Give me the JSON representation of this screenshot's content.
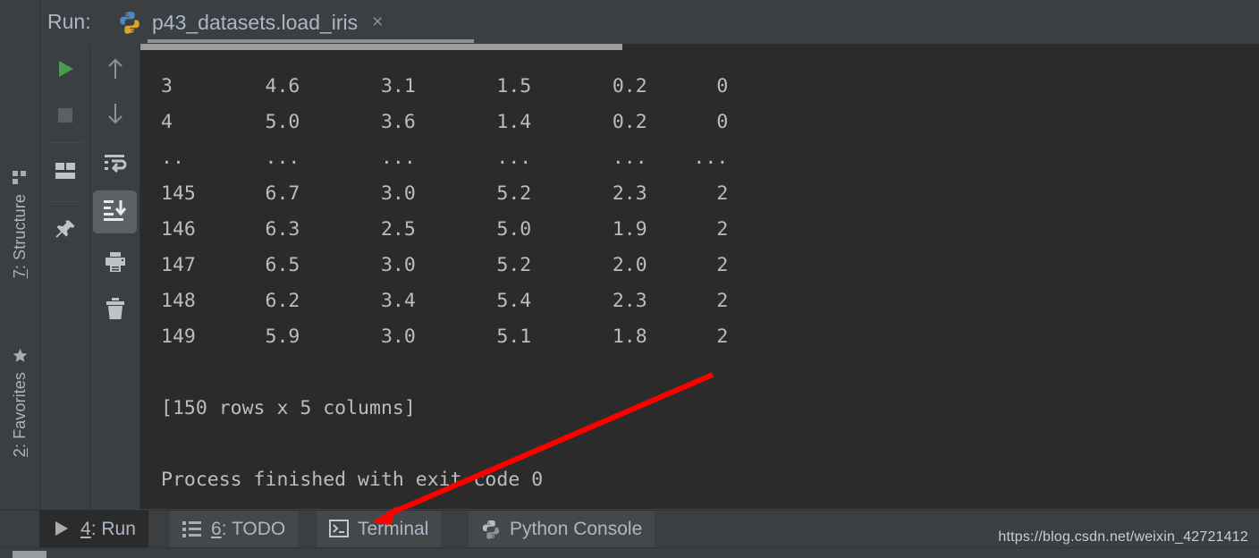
{
  "window": {
    "run_label": "Run:",
    "tab_title": "p43_datasets.load_iris",
    "tab_close": "×",
    "tab_icon": "python-icon"
  },
  "left_stripe": {
    "items": [
      {
        "label_mnemonic": "7",
        "label_rest": ": Structure",
        "icon": "structure-icon",
        "name": "structure"
      },
      {
        "label_mnemonic": "2",
        "label_rest": ": Favorites",
        "icon": "star-icon",
        "name": "favorites"
      }
    ]
  },
  "toolbar_run": {
    "buttons": [
      {
        "name": "rerun-button",
        "icon": "play-icon",
        "active": false
      },
      {
        "name": "stop-button",
        "icon": "stop-square-icon",
        "active": false
      },
      {
        "name": "restore-layout-button",
        "icon": "layout-icon",
        "active": false
      },
      {
        "name": "pin-tab-button",
        "icon": "pin-icon",
        "active": false
      }
    ]
  },
  "toolbar_console": {
    "buttons": [
      {
        "name": "up-the-stack-button",
        "icon": "arrow-up-icon",
        "active": false
      },
      {
        "name": "down-the-stack-button",
        "icon": "arrow-down-icon",
        "active": false
      },
      {
        "name": "soft-wrap-button",
        "icon": "soft-wrap-icon",
        "active": false
      },
      {
        "name": "scroll-to-end-button",
        "icon": "scroll-to-end-icon",
        "active": true
      },
      {
        "name": "print-button",
        "icon": "printer-icon",
        "active": false
      },
      {
        "name": "clear-all-button",
        "icon": "trash-icon",
        "active": false
      }
    ]
  },
  "console": {
    "output": "3        4.6       3.1       1.5       0.2      0\n4        5.0       3.6       1.4       0.2      0\n..       ...       ...       ...       ...    ...\n145      6.7       3.0       5.2       2.3      2\n146      6.3       2.5       5.0       1.9      2\n147      6.5       3.0       5.2       2.0      2\n148      6.2       3.4       5.4       2.3      2\n149      5.9       3.0       5.1       1.8      2\n\n[150 rows x 5 columns]\n\nProcess finished with exit code 0",
    "rows": [
      {
        "index": "3",
        "sepal_length": "4.6",
        "sepal_width": "3.1",
        "petal_length": "1.5",
        "petal_width": "0.2",
        "target": "0"
      },
      {
        "index": "4",
        "sepal_length": "5.0",
        "sepal_width": "3.6",
        "petal_length": "1.4",
        "petal_width": "0.2",
        "target": "0"
      },
      {
        "index": "..",
        "sepal_length": "...",
        "sepal_width": "...",
        "petal_length": "...",
        "petal_width": "...",
        "target": "..."
      },
      {
        "index": "145",
        "sepal_length": "6.7",
        "sepal_width": "3.0",
        "petal_length": "5.2",
        "petal_width": "2.3",
        "target": "2"
      },
      {
        "index": "146",
        "sepal_length": "6.3",
        "sepal_width": "2.5",
        "petal_length": "5.0",
        "petal_width": "1.9",
        "target": "2"
      },
      {
        "index": "147",
        "sepal_length": "6.5",
        "sepal_width": "3.0",
        "petal_length": "5.2",
        "petal_width": "2.0",
        "target": "2"
      },
      {
        "index": "148",
        "sepal_length": "6.2",
        "sepal_width": "3.4",
        "petal_length": "5.4",
        "petal_width": "2.3",
        "target": "2"
      },
      {
        "index": "149",
        "sepal_length": "5.9",
        "sepal_width": "3.0",
        "petal_length": "5.1",
        "petal_width": "1.8",
        "target": "2"
      }
    ],
    "shape_line": "[150 rows x 5 columns]",
    "exit_line": "Process finished with exit code 0"
  },
  "bottom_tabs": [
    {
      "name": "tab-run",
      "mnemonic": "4",
      "label": ": Run",
      "icon": "play-icon",
      "active": true
    },
    {
      "name": "tab-todo",
      "mnemonic": "6",
      "label": ": TODO",
      "icon": "todo-icon",
      "active": false
    },
    {
      "name": "tab-terminal",
      "mnemonic": "",
      "label": "Terminal",
      "icon": "terminal-icon",
      "active": false
    },
    {
      "name": "tab-python-console",
      "mnemonic": "",
      "label": "Python Console",
      "icon": "python-icon",
      "active": false
    }
  ],
  "watermark": "https://blog.csdn.net/weixin_42721412",
  "colors": {
    "console_bg": "#2b2b2b",
    "panel_bg": "#3c3f41",
    "text": "#a9b7c6",
    "console_text": "#bcbcbc",
    "accent_green": "#4a9a4f",
    "annotation_red": "#fe0000",
    "active_button_bg": "#5c6164"
  }
}
